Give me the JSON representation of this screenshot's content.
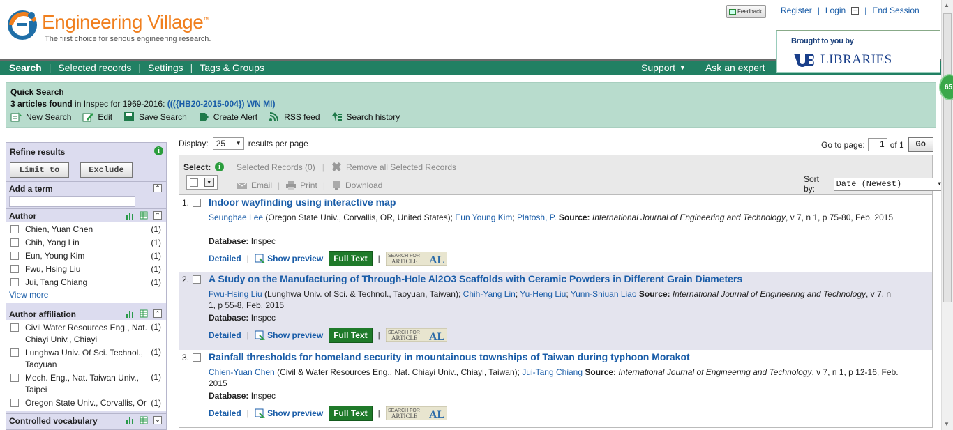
{
  "header": {
    "title": "Engineering Village",
    "trademark": "™",
    "tagline": "The first choice for serious engineering research.",
    "feedback": "Feedback",
    "links": [
      "Register",
      "Login",
      "End Session"
    ],
    "brought_by": "Brought to you by",
    "library": "LIBRARIES"
  },
  "nav": {
    "left": [
      "Search",
      "Selected records",
      "Settings",
      "Tags & Groups"
    ],
    "right": [
      "Support",
      "Ask an expert"
    ]
  },
  "quick_search": {
    "title": "Quick Search",
    "count": "3 articles found",
    "in_text": " in Inspec for 1969-2016: ",
    "query": "((({HB20-2015-004}) WN MI)",
    "tools": [
      "New Search",
      "Edit",
      "Save Search",
      "Create Alert",
      "RSS feed",
      "Search history"
    ]
  },
  "sidebar": {
    "title": "Refine results",
    "limit_to": "Limit to",
    "exclude": "Exclude",
    "add_term": "Add a term",
    "author": {
      "title": "Author",
      "items": [
        {
          "label": "Chien, Yuan Chen",
          "count": "(1)"
        },
        {
          "label": "Chih, Yang Lin",
          "count": "(1)"
        },
        {
          "label": "Eun, Young Kim",
          "count": "(1)"
        },
        {
          "label": "Fwu, Hsing Liu",
          "count": "(1)"
        },
        {
          "label": "Jui, Tang Chiang",
          "count": "(1)"
        }
      ],
      "view_more": "View more"
    },
    "affiliation": {
      "title": "Author affiliation",
      "items": [
        {
          "label1": "Civil Water Resources Eng., Nat.",
          "label2": "Chiayi Univ., Chiayi",
          "count": "(1)"
        },
        {
          "label1": "Lunghwa Univ. Of Sci. Technol.,",
          "label2": "Taoyuan",
          "count": "(1)"
        },
        {
          "label1": "Mech. Eng., Nat. Taiwan Univ.,",
          "label2": "Taipei",
          "count": "(1)"
        },
        {
          "label1": "Oregon State Univ., Corvallis, Or",
          "label2": "",
          "count": "(1)"
        }
      ]
    },
    "vocab": {
      "title": "Controlled vocabulary"
    }
  },
  "display": {
    "label": "Display:",
    "value": "25",
    "suffix": "results per page"
  },
  "paging": {
    "label": "Go to page:",
    "page": "1",
    "of": "of 1",
    "go": "Go"
  },
  "select_bar": {
    "select": "Select:",
    "selected_records": "Selected Records (0)",
    "remove_all": "Remove all Selected Records",
    "email": "Email",
    "print": "Print",
    "download": "Download",
    "sort_label": "Sort by:",
    "sort_value": "Date (Newest)"
  },
  "results": [
    {
      "num": "1.",
      "title": "Indoor wayfinding using interactive map",
      "authors": [
        {
          "name": "Seunghae Lee",
          "aff": " (Oregon State Univ., Corvallis, OR, United States); "
        },
        {
          "name": "Eun Young Kim",
          "aff": "; "
        },
        {
          "name": "Platosh, P.",
          "aff": "  "
        }
      ],
      "source_label": "Source:",
      "source": "International Journal of Engineering and Technology",
      "source_rest": ", v 7, n 1, p 75-80, Feb. 2015",
      "db_label": "Database:",
      "db": "Inspec"
    },
    {
      "num": "2.",
      "title": "A Study on the Manufacturing of Through-Hole Al2O3 Scaffolds with Ceramic Powders in Different Grain Diameters",
      "authors": [
        {
          "name": "Fwu-Hsing Liu",
          "aff": " (Lunghwa Univ. of Sci. & Technol., Taoyuan, Taiwan); "
        },
        {
          "name": "Chih-Yang Lin",
          "aff": "; "
        },
        {
          "name": "Yu-Heng Liu",
          "aff": "; "
        },
        {
          "name": "Yunn-Shiuan Liao",
          "aff": "  "
        }
      ],
      "source_label": "Source:",
      "source": "International Journal of Engineering and Technology",
      "source_rest": ", v 7, n 1, p 55-8, Feb. 2015",
      "db_label": "Database:",
      "db": "Inspec"
    },
    {
      "num": "3.",
      "title": "Rainfall thresholds for homeland security in mountainous townships of Taiwan during typhoon Morakot",
      "authors": [
        {
          "name": "Chien-Yuan Chen",
          "aff": " (Civil & Water Resources Eng., Nat. Chiayi Univ., Chiayi, Taiwan); "
        },
        {
          "name": "Jui-Tang Chiang",
          "aff": "  "
        }
      ],
      "source_label": "Source:",
      "source": "International Journal of Engineering and Technology",
      "source_rest": ", v 7, n 1, p 12-16, Feb. 2015",
      "db_label": "Database:",
      "db": "Inspec"
    }
  ],
  "actions": {
    "detailed": "Detailed",
    "preview": "Show preview",
    "full_text": "Full Text",
    "search_for": "SEARCH FOR",
    "article": "ARTICLE",
    "al": "AL"
  },
  "badge": "65",
  "colors": {
    "nav": "#218063",
    "quick": "#b8dccd",
    "sidebar": "#dcdcef",
    "accent": "#f07f1e",
    "link": "#1a5da8"
  }
}
